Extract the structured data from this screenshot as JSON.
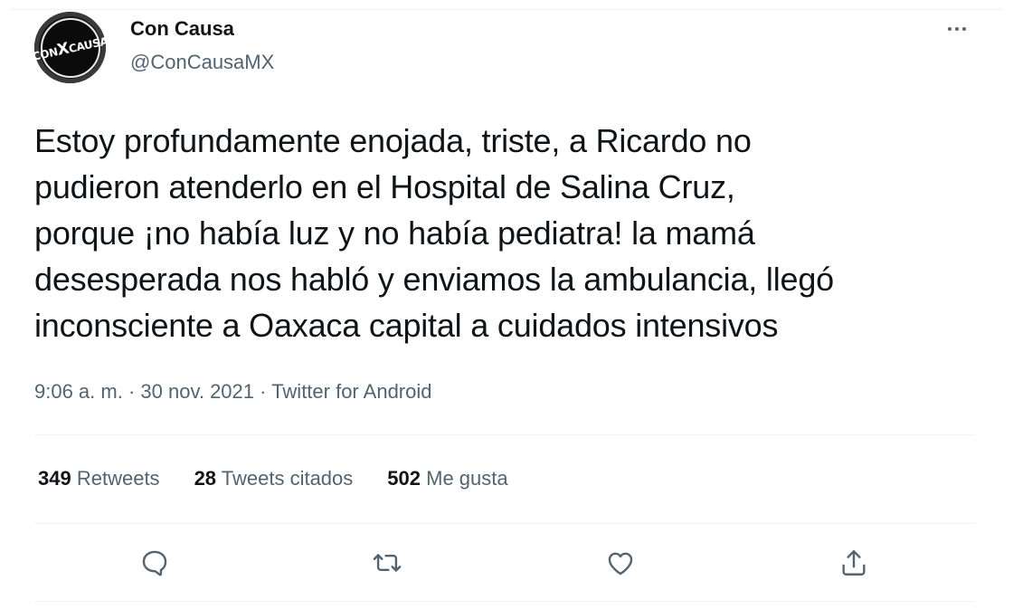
{
  "author": {
    "name": "Con Causa",
    "handle": "@ConCausaMX",
    "avatar_logo": "CONCAUSA"
  },
  "tweet": {
    "text": "Estoy profundamente enojada, triste, a Ricardo no\npudieron atenderlo en el Hospital de Salina Cruz,\nporque ¡no había luz y no había pediatra! la mamá\ndesesperada nos habló y enviamos la ambulancia, llegó\ninconsciente a Oaxaca capital a cuidados intensivos",
    "time": "9:06 a. m.",
    "date": "30 nov. 2021",
    "source": "Twitter for Android",
    "dot": "·"
  },
  "stats": {
    "retweets_count": "349",
    "retweets_label": "Retweets",
    "quotes_count": "28",
    "quotes_label": "Tweets citados",
    "likes_count": "502",
    "likes_label": "Me gusta"
  },
  "icons": {
    "more": "more-dots-icon",
    "reply": "reply-icon",
    "retweet": "retweet-icon",
    "like": "heart-icon",
    "share": "share-icon"
  },
  "colors": {
    "text": "#0f1419",
    "secondary": "#536471",
    "divider": "#eff3f4"
  }
}
